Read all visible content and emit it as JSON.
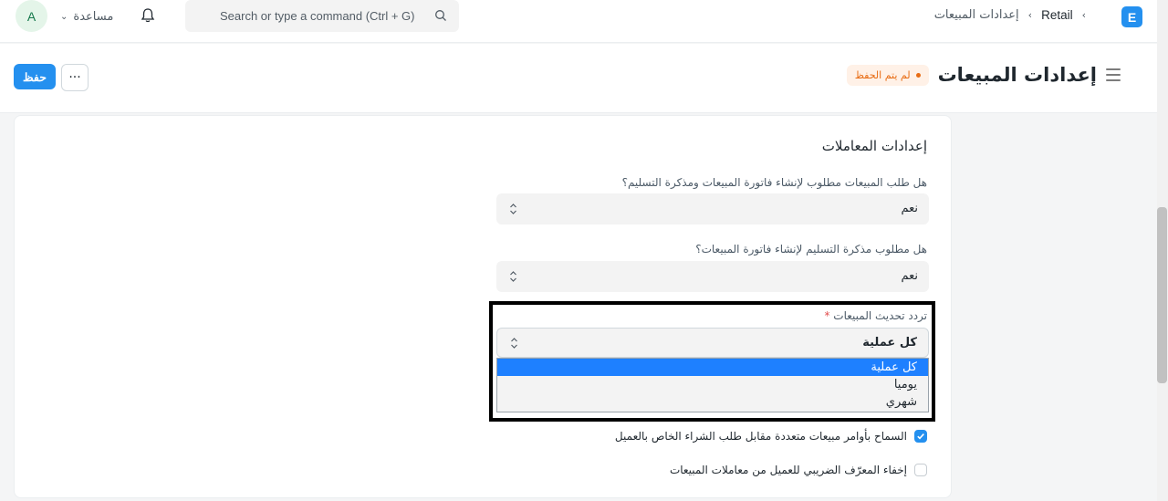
{
  "navbar": {
    "avatar_initial": "A",
    "help_label": "مساعدة",
    "search_placeholder": "Search or type a command (Ctrl + G)",
    "breadcrumbs": [
      "Retail",
      "إعدادات المبيعات"
    ],
    "logo_letter": "E"
  },
  "page": {
    "title": "إعدادات المبيعات",
    "status_badge": "لم يتم الحفظ",
    "save_label": "حفظ",
    "more_label": "···"
  },
  "form": {
    "section_title": "إعدادات المعاملات",
    "fields": [
      {
        "label": "هل طلب المبيعات مطلوب لإنشاء فاتورة المبيعات ومذكرة التسليم؟",
        "value": "نعم"
      },
      {
        "label": "هل مطلوب مذكرة التسليم لإنشاء فاتورة المبيعات؟",
        "value": "نعم"
      }
    ],
    "frequency": {
      "label": "تردد تحديث المبيعات",
      "required_mark": "*",
      "value": "كل عملية",
      "options": [
        "كل عملية",
        "يوميا",
        "شهري"
      ],
      "selected_index": 0
    },
    "checkboxes": [
      {
        "label": "السماح بأوامر مبيعات متعددة مقابل طلب الشراء الخاص بالعميل",
        "checked": true
      },
      {
        "label": "إخفاء المعرّف الضريبي للعميل من معاملات المبيعات",
        "checked": false
      }
    ]
  },
  "colors": {
    "accent": "#2490ef",
    "badge_text": "#e86c13",
    "badge_bg": "#fff1e7",
    "dropdown_selected": "#1e80ff"
  }
}
